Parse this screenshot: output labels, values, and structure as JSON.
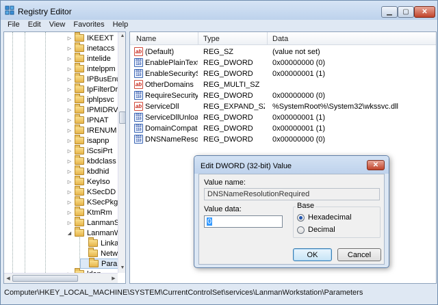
{
  "window": {
    "title": "Registry Editor"
  },
  "menu": [
    "File",
    "Edit",
    "View",
    "Favorites",
    "Help"
  ],
  "tree": [
    {
      "label": "IKEEXT",
      "indent": 0,
      "exp": "▷"
    },
    {
      "label": "inetaccs",
      "indent": 0,
      "exp": "▷"
    },
    {
      "label": "intelide",
      "indent": 0,
      "exp": "▷"
    },
    {
      "label": "intelppm",
      "indent": 0,
      "exp": "▷"
    },
    {
      "label": "IPBusEnum",
      "indent": 0,
      "exp": "▷"
    },
    {
      "label": "IpFilterDriv",
      "indent": 0,
      "exp": "▷"
    },
    {
      "label": "iphlpsvc",
      "indent": 0,
      "exp": "▷"
    },
    {
      "label": "IPMIDRV",
      "indent": 0,
      "exp": "▷"
    },
    {
      "label": "IPNAT",
      "indent": 0,
      "exp": "▷"
    },
    {
      "label": "IRENUM",
      "indent": 0,
      "exp": "▷"
    },
    {
      "label": "isapnp",
      "indent": 0,
      "exp": "▷"
    },
    {
      "label": "iScsiPrt",
      "indent": 0,
      "exp": "▷"
    },
    {
      "label": "kbdclass",
      "indent": 0,
      "exp": "▷"
    },
    {
      "label": "kbdhid",
      "indent": 0,
      "exp": "▷"
    },
    {
      "label": "KeyIso",
      "indent": 0,
      "exp": "▷"
    },
    {
      "label": "KSecDD",
      "indent": 0,
      "exp": "▷"
    },
    {
      "label": "KSecPkg",
      "indent": 0,
      "exp": "▷"
    },
    {
      "label": "KtmRm",
      "indent": 0,
      "exp": "▷"
    },
    {
      "label": "LanmanSer",
      "indent": 0,
      "exp": "▷"
    },
    {
      "label": "LanmanWo",
      "indent": 0,
      "exp": "◢"
    },
    {
      "label": "Linkage",
      "indent": 1,
      "exp": ""
    },
    {
      "label": "Networ",
      "indent": 1,
      "exp": ""
    },
    {
      "label": "Parame",
      "indent": 1,
      "exp": "",
      "selected": true
    },
    {
      "label": "ldap",
      "indent": 0,
      "exp": "▷"
    }
  ],
  "list": {
    "columns": [
      "Name",
      "Type",
      "Data"
    ],
    "rows": [
      {
        "icon": "string-value-icon",
        "name": "(Default)",
        "type": "REG_SZ",
        "data": "(value not set)"
      },
      {
        "icon": "binary-value-icon",
        "name": "EnablePlainText...",
        "type": "REG_DWORD",
        "data": "0x00000000 (0)"
      },
      {
        "icon": "binary-value-icon",
        "name": "EnableSecuritySi...",
        "type": "REG_DWORD",
        "data": "0x00000001 (1)"
      },
      {
        "icon": "string-value-icon",
        "name": "OtherDomains",
        "type": "REG_MULTI_SZ",
        "data": ""
      },
      {
        "icon": "binary-value-icon",
        "name": "RequireSecurity...",
        "type": "REG_DWORD",
        "data": "0x00000000 (0)"
      },
      {
        "icon": "string-value-icon",
        "name": "ServiceDll",
        "type": "REG_EXPAND_SZ",
        "data": "%SystemRoot%\\System32\\wkssvc.dll"
      },
      {
        "icon": "binary-value-icon",
        "name": "ServiceDllUnloa...",
        "type": "REG_DWORD",
        "data": "0x00000001 (1)"
      },
      {
        "icon": "binary-value-icon",
        "name": "DomainCompat...",
        "type": "REG_DWORD",
        "data": "0x00000001 (1)"
      },
      {
        "icon": "binary-value-icon",
        "name": "DNSNameResol...",
        "type": "REG_DWORD",
        "data": "0x00000000 (0)"
      }
    ]
  },
  "status": {
    "path": "Computer\\HKEY_LOCAL_MACHINE\\SYSTEM\\CurrentControlSet\\services\\LanmanWorkstation\\Parameters"
  },
  "dialog": {
    "title": "Edit DWORD (32-bit) Value",
    "value_name_label": "Value name:",
    "value_name": "DNSNameResolutionRequired",
    "value_data_label": "Value data:",
    "value_data": "0",
    "base_label": "Base",
    "hex_label": "Hexadecimal",
    "dec_label": "Decimal",
    "ok_label": "OK",
    "cancel_label": "Cancel"
  }
}
